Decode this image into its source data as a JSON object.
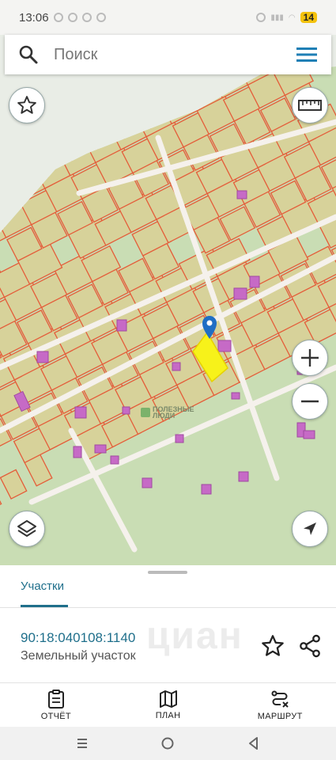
{
  "status_bar": {
    "time": "13:06",
    "battery": "14"
  },
  "search": {
    "placeholder": "Поиск"
  },
  "map": {
    "watermark_line1": "ПОЛЕЗНЫЕ",
    "watermark_line2": "ЛЮДИ",
    "colors": {
      "parcel_fill": "#d7d29a",
      "parcel_border": "#e45d3a",
      "selected": "#f7f21a",
      "building": "#c66ac6",
      "road": "#f5f1ec",
      "green": "#c9ddb4",
      "pin": "#1f6ec4"
    },
    "buttons": {
      "favorite": "star-icon",
      "ruler": "ruler-icon",
      "zoom_in": "plus-icon",
      "zoom_out": "minus-icon",
      "layers": "layers-icon",
      "locate": "navigation-arrow-icon"
    }
  },
  "sheet": {
    "tab": "Участки",
    "parcel": {
      "id": "90:18:040108:1140",
      "type": "Земельный участок"
    },
    "watermark": "циан",
    "actions": [
      {
        "label": "ОТЧЁТ",
        "icon": "clipboard-icon"
      },
      {
        "label": "ПЛАН",
        "icon": "map-icon"
      },
      {
        "label": "МАРШРУТ",
        "icon": "route-icon"
      }
    ]
  },
  "nav": {
    "icons": [
      "recent-apps-icon",
      "home-icon",
      "back-icon"
    ]
  }
}
